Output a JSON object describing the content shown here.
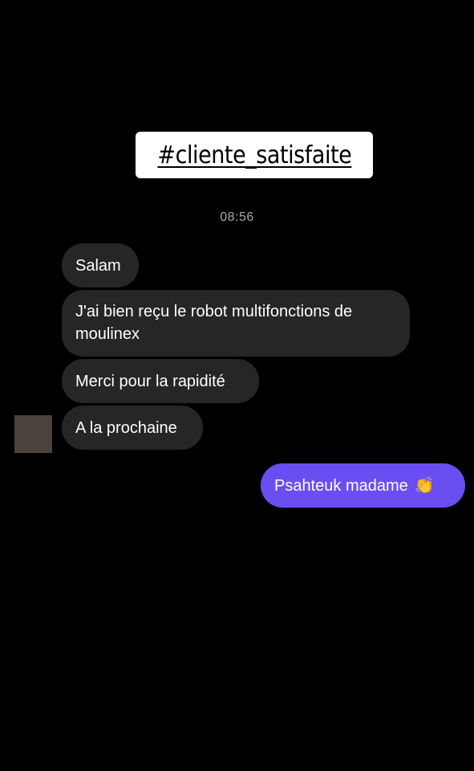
{
  "story": {
    "hashtag": "#cliente_satisfaite"
  },
  "chat": {
    "timestamp": "08:56",
    "received": [
      {
        "text": "Salam"
      },
      {
        "text": "J'ai bien reçu le robot multifonctions de moulinex"
      },
      {
        "text": "Merci pour la rapidité"
      },
      {
        "text": "A la prochaine"
      }
    ],
    "sent": {
      "text": "Psahteuk madame",
      "emoji": "👏"
    }
  },
  "colors": {
    "background": "#000000",
    "received_bubble": "#262626",
    "sent_bubble": "#6b4ef2",
    "timestamp": "#a8a8a8"
  }
}
